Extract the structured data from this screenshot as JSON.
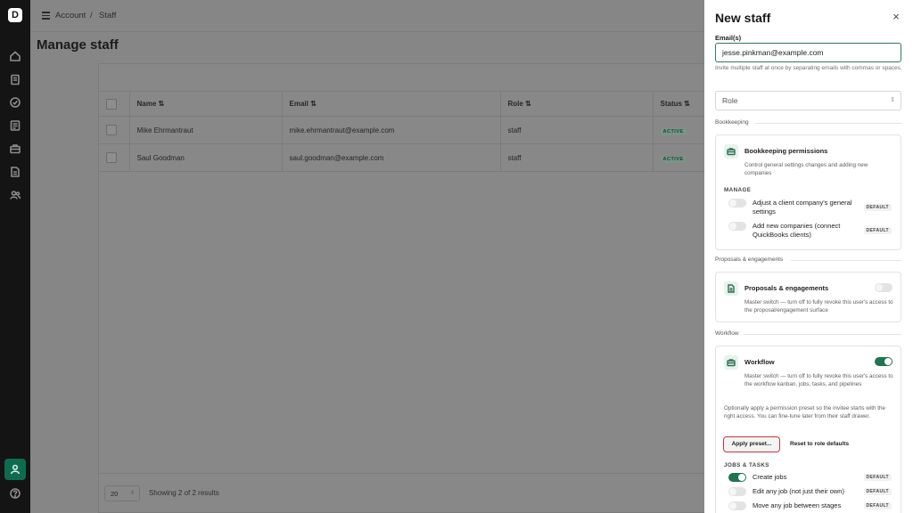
{
  "app": {
    "logo_letter": "D"
  },
  "rail": {
    "icons": [
      "home-icon",
      "clipboard-icon",
      "check-circle-icon",
      "ledger-icon",
      "briefcase-icon",
      "document-icon",
      "users-icon",
      "user-icon",
      "help-icon"
    ],
    "active": "user-icon"
  },
  "breadcrumb": {
    "root": "Account",
    "sep": "/",
    "current": "Staff"
  },
  "page": {
    "title": "Manage staff"
  },
  "table": {
    "columns": [
      "Name ⇅",
      "Email ⇅",
      "Role ⇅",
      "Status ⇅"
    ],
    "rows": [
      {
        "name": "Mike Ehrmantraut",
        "email": "mike.ehrmantraut@example.com",
        "role": "staff",
        "status": "ACTIVE"
      },
      {
        "name": "Saul Goodman",
        "email": "saul.goodman@example.com",
        "role": "staff",
        "status": "ACTIVE"
      }
    ]
  },
  "pager": {
    "page_size": "20",
    "info": "Showing 2 of 2 results"
  },
  "drawer": {
    "title": "New staff",
    "close": "×",
    "email_label": "Email(s)",
    "email_value": "jesse.pinkman@example.com",
    "email_help": "Invite multiple staff at once by separating emails with commas or spaces.",
    "role_placeholder": "Role",
    "sections": {
      "bookkeeping": {
        "header": "Bookkeeping",
        "title": "Bookkeeping permissions",
        "desc": "Control general settings changes and adding new companies",
        "manage_header": "MANAGE",
        "options": [
          {
            "label": "Adjust a client company's general settings",
            "badge": "DEFAULT",
            "on": false
          },
          {
            "label": "Add new companies (connect QuickBooks clients)",
            "badge": "DEFAULT",
            "on": false
          }
        ]
      },
      "proposals": {
        "header": "Proposals & engagements",
        "title": "Proposals & engagements",
        "desc": "Master switch — turn off to fully revoke this user's access to the proposal/engagement surface",
        "on": false
      },
      "workflow": {
        "header": "Workflow",
        "title": "Workflow",
        "desc": "Master switch — turn off to fully revoke this user's access to the workflow kanban, jobs, tasks, and pipelines",
        "on": true,
        "preset_note": "Optionally apply a permission preset so the invitee starts with the right access. You can fine-tune later from their staff drawer.",
        "apply_preset": "Apply preset...",
        "reset": "Reset to role defaults",
        "jobs_header": "JOBS & TASKS",
        "options": [
          {
            "label": "Create jobs",
            "badge": "DEFAULT",
            "on": true
          },
          {
            "label": "Edit any job (not just their own)",
            "badge": "DEFAULT",
            "on": false
          },
          {
            "label": "Move any job between stages",
            "badge": "DEFAULT",
            "on": false
          }
        ]
      }
    }
  },
  "colors": {
    "accent": "#1f7351",
    "highlight": "#c8363c"
  }
}
